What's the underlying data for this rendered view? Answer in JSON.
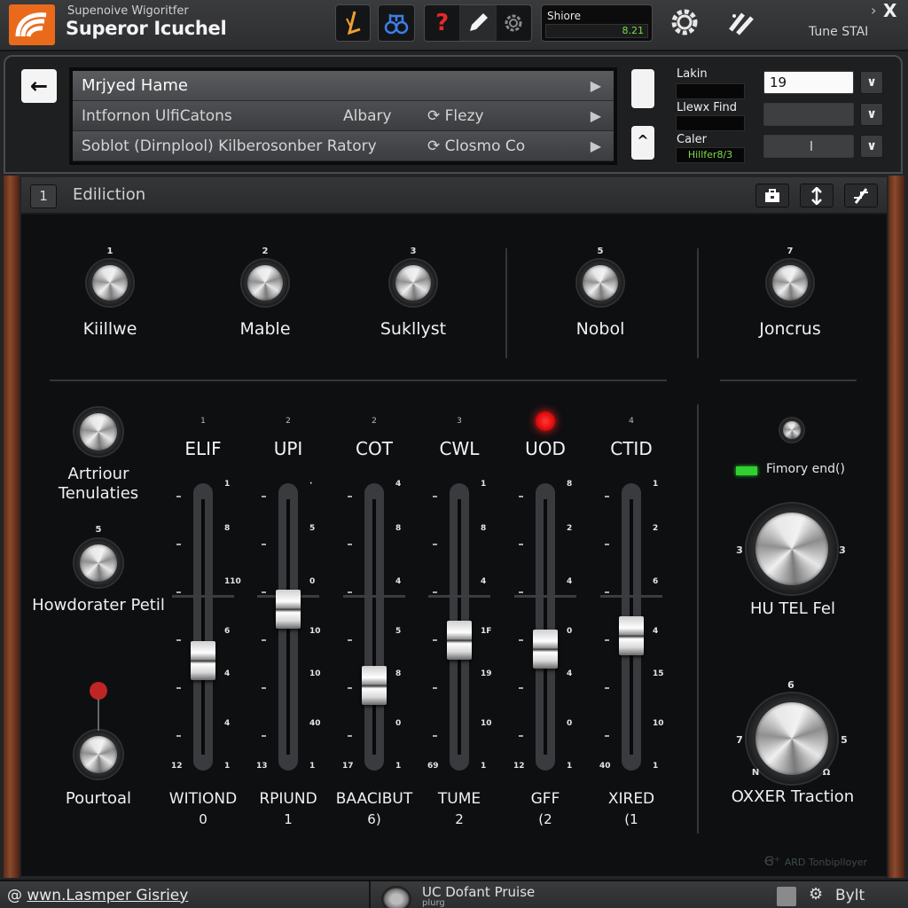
{
  "titlebar": {
    "subtitle": "Supenoive Wigoritfer",
    "title": "Superor Icuchel",
    "store_label": "Shiore",
    "store_value": "8.21",
    "right_label": "Tune STAI",
    "close_glyph": "X",
    "chevron_glyph": "›",
    "icons": [
      "draw-tool-icon",
      "instrument-icon",
      "help-icon",
      "pencil-icon",
      "settings-small-icon",
      "gear-icon",
      "slash-tool-icon"
    ],
    "help_glyph": "?"
  },
  "browser": {
    "back_glyph": "←",
    "rows": [
      {
        "name": "Mrjyed Hame",
        "col2": "",
        "col3": "",
        "selected": true
      },
      {
        "name": "Intfornon UlfiCatons",
        "col2": "Albary",
        "col3": "Flezy",
        "selected": false
      },
      {
        "name": "Soblot (Dirnplool) Kilberosonber Ratory",
        "col2": "",
        "col3": "Closmo Co",
        "selected": false
      }
    ],
    "play_glyph": "▶",
    "up_glyph": "^",
    "fields": [
      {
        "label": "Lakin",
        "value": "",
        "dropdown_value": "19"
      },
      {
        "label": "Llewx Find",
        "value": "",
        "dropdown_value": ""
      },
      {
        "label": "Caler",
        "value": "Hillfer8/3",
        "dropdown_value": "I"
      }
    ],
    "dropdown_glyph": "⌄"
  },
  "device": {
    "number": "1",
    "title": "Ediliction",
    "top_knobs": [
      {
        "num": "1",
        "label": "Kiillwe"
      },
      {
        "num": "2",
        "label": "Mable"
      },
      {
        "num": "3",
        "label": "Sukllyst"
      },
      {
        "num": "5",
        "label": "Nobol"
      },
      {
        "num": "7",
        "label": "Joncrus"
      }
    ],
    "left_knobs": [
      {
        "num": "",
        "label": "Artriour Tenulaties"
      },
      {
        "num": "5",
        "label": "Howdorater Petil"
      },
      {
        "num": "",
        "label": "Pourtoal"
      }
    ],
    "faders": [
      {
        "top": "1",
        "name": "ELIF",
        "bottom": "WITIOND",
        "value_label": "0",
        "level": 0.35,
        "ticks": [
          "1",
          "8",
          "110",
          "6",
          "4",
          "4",
          "1"
        ],
        "bottom_left": "12"
      },
      {
        "top": "2",
        "name": "UPI",
        "bottom": "RPIUND",
        "value_label": "1",
        "level": 0.58,
        "ticks": [
          "·",
          "5",
          "0",
          "10",
          "10",
          "40",
          "1"
        ],
        "bottom_left": "13"
      },
      {
        "top": "2",
        "name": "COT",
        "bottom": "BAACIBUT",
        "value_label": "6)",
        "level": 0.24,
        "ticks": [
          "4",
          "8",
          "4",
          "5",
          "8",
          "0",
          "1"
        ],
        "bottom_left": "17"
      },
      {
        "top": "3",
        "name": "CWL",
        "bottom": "TUME",
        "value_label": "2",
        "level": 0.44,
        "ticks": [
          "1",
          "8",
          "4",
          "1F",
          "19",
          "10",
          "1"
        ],
        "bottom_left": "69"
      },
      {
        "top": "",
        "name": "UOD",
        "bottom": "GFF",
        "value_label": "(2",
        "level": 0.4,
        "ticks": [
          "8",
          "2",
          "4",
          "0",
          "4",
          "0",
          "1"
        ],
        "bottom_left": "12",
        "led": true
      },
      {
        "top": "4",
        "name": "CTID",
        "bottom": "XIRED",
        "value_label": "(1",
        "level": 0.46,
        "ticks": [
          "1",
          "2",
          "6",
          "4",
          "15",
          "10",
          "1"
        ],
        "bottom_left": "40"
      }
    ],
    "right": {
      "indicator_label": "Fimory end()",
      "big_knob1": {
        "label": "HU TEL Fel",
        "left_num": "3",
        "right_num": "3"
      },
      "big_knob2": {
        "label": "OXXER Traction",
        "top_num": "6",
        "left_num": "7",
        "right_num": "5",
        "bl_num": "N",
        "br_num": "Ω"
      }
    },
    "brand": "ARD Tonbiplloyer"
  },
  "statusbar": {
    "url": "wwn.Lasmper Gisriey",
    "plugin_name": "UC Dofant Pruise",
    "plugin_sub": "plurg",
    "right_label": "Bylt"
  },
  "colors": {
    "accent_orange": "#ea6a1c",
    "led_red": "#e00a0a",
    "led_green": "#30d030",
    "value_green": "#7bdc4a"
  }
}
